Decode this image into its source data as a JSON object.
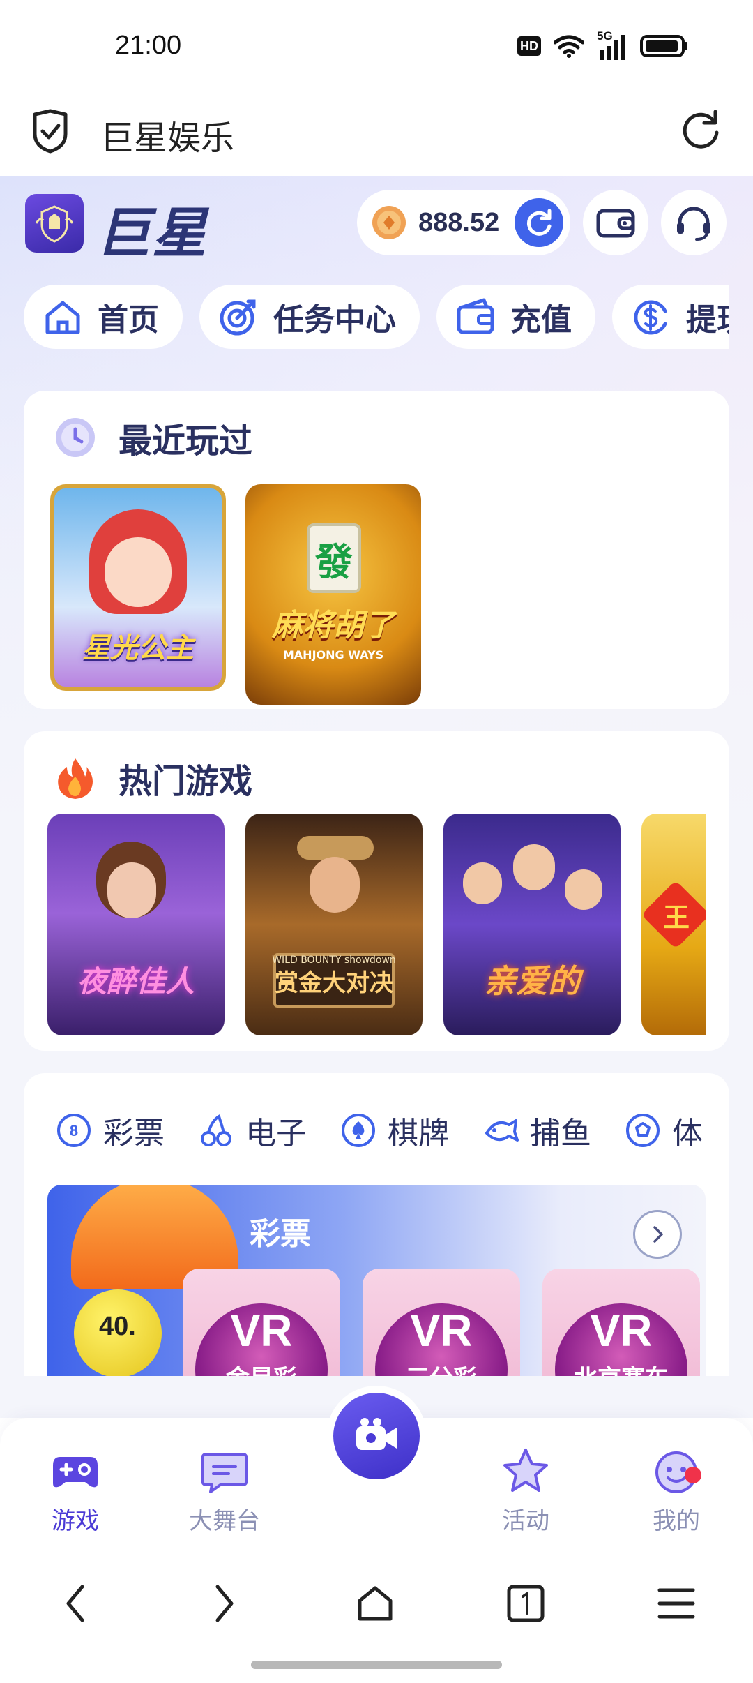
{
  "status_bar": {
    "time": "21:00",
    "hd": "HD",
    "network": "5G"
  },
  "browser": {
    "title": "巨星娱乐"
  },
  "header": {
    "logo_text": "巨星",
    "balance": "888.52"
  },
  "nav_chips": [
    {
      "label": "首页",
      "icon": "home-icon"
    },
    {
      "label": "任务中心",
      "icon": "target-icon"
    },
    {
      "label": "充值",
      "icon": "wallet-icon"
    },
    {
      "label": "提现",
      "icon": "dollar-icon"
    }
  ],
  "recent": {
    "title": "最近玩过",
    "games": [
      {
        "label": "星光公主"
      },
      {
        "label": "麻将胡了",
        "sub": "MAHJONG WAYS",
        "tile_char": "發"
      }
    ]
  },
  "hot": {
    "title": "热门游戏",
    "games": [
      {
        "label": "夜醉佳人"
      },
      {
        "label": "赏金大对决",
        "sub": "WILD BOUNTY showdown"
      },
      {
        "label": "亲爱的"
      },
      {
        "label": "王"
      }
    ]
  },
  "categories": [
    {
      "label": "彩票",
      "icon": "lottery-8-ball-icon"
    },
    {
      "label": "电子",
      "icon": "cherry-icon"
    },
    {
      "label": "棋牌",
      "icon": "spade-chip-icon"
    },
    {
      "label": "捕鱼",
      "icon": "fish-icon"
    },
    {
      "label": "体育",
      "icon": "soccer-ball-icon"
    }
  ],
  "lottery_banner": {
    "title": "彩票",
    "ball_number": "40.",
    "cards": [
      {
        "logo": "VR",
        "sub": "金星彩"
      },
      {
        "logo": "VR",
        "sub": "三分彩"
      },
      {
        "logo": "VR",
        "sub": "北京赛车"
      }
    ]
  },
  "tab_bar": {
    "tabs": [
      {
        "label": "游戏"
      },
      {
        "label": "大舞台"
      },
      {
        "label": "活动"
      },
      {
        "label": "我的"
      }
    ]
  },
  "colors": {
    "accent": "#3f63ea",
    "brand_purple": "#4b3bd6",
    "title_text": "#2a3060",
    "notification": "#f0324a"
  }
}
